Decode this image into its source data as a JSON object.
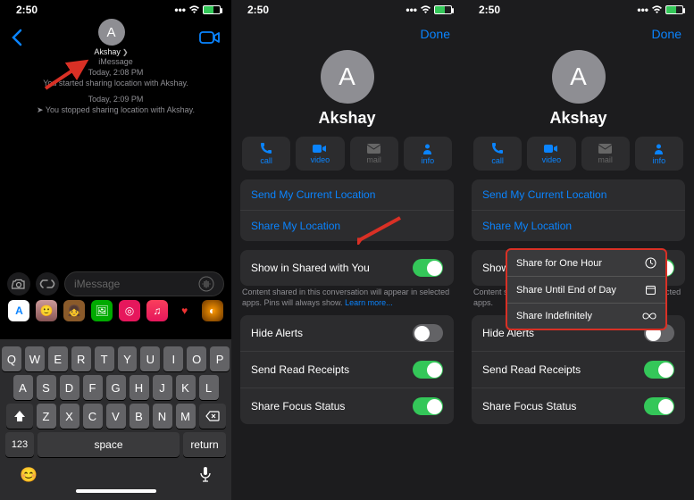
{
  "status": {
    "time": "2:50"
  },
  "pane1": {
    "contact": "Akshay",
    "header_line": "iMessage",
    "ts1": "Today, 2:08 PM",
    "msg1": "You started sharing location with Akshay.",
    "ts2": "Today, 2:09 PM",
    "msg2": "You stopped sharing location with Akshay.",
    "placeholder": "iMessage",
    "keyboard": {
      "r1": [
        "Q",
        "W",
        "E",
        "R",
        "T",
        "Y",
        "U",
        "I",
        "O",
        "P"
      ],
      "r2": [
        "A",
        "S",
        "D",
        "F",
        "G",
        "H",
        "J",
        "K",
        "L"
      ],
      "r3": [
        "Z",
        "X",
        "C",
        "V",
        "B",
        "N",
        "M"
      ],
      "k123": "123",
      "space": "space",
      "return": "return"
    }
  },
  "detail": {
    "done": "Done",
    "name": "Akshay",
    "actions": {
      "call": "call",
      "video": "video",
      "mail": "mail",
      "info": "info"
    },
    "send_current": "Send My Current Location",
    "share_my": "Share My Location",
    "shared_with_you": "Show in Shared with You",
    "shared_with_you_short": "Show",
    "hint_pre": "Content shared in this conversation will appear in selected apps. Pins will always show. ",
    "hint_link": "Learn more...",
    "hint_short": "Content shared in this conversation will appear in selected apps. ",
    "hide_alerts": "Hide Alerts",
    "read_receipts": "Send Read Receipts",
    "focus": "Share Focus Status"
  },
  "popover": {
    "opt1": "Share for One Hour",
    "opt2": "Share Until End of Day",
    "opt3": "Share Indefinitely"
  }
}
